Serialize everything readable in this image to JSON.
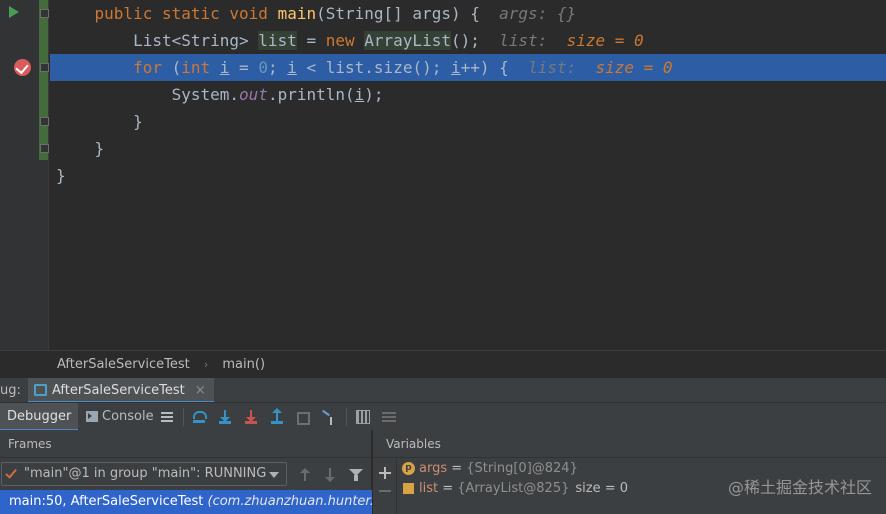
{
  "editor": {
    "lines": [
      {
        "indent": "    ",
        "parts": [
          {
            "t": "public static void ",
            "c": "kw"
          },
          {
            "t": "main",
            "c": "fn"
          },
          {
            "t": "(String[] args) {  ",
            "c": ""
          },
          {
            "t": "args: {}",
            "c": "hint"
          }
        ]
      },
      {
        "indent": "        ",
        "parts": [
          {
            "t": "List<String> ",
            "c": ""
          },
          {
            "t": "list",
            "c": "hl"
          },
          {
            "t": " = ",
            "c": ""
          },
          {
            "t": "new ",
            "c": "kw"
          },
          {
            "t": "ArrayList",
            "c": "hl"
          },
          {
            "t": "();  ",
            "c": ""
          },
          {
            "t": "list:  ",
            "c": "hint"
          },
          {
            "t": "size = 0",
            "c": "hint-val"
          }
        ]
      },
      {
        "indent": "        ",
        "exec": true,
        "parts": [
          {
            "t": "for ",
            "c": "kw"
          },
          {
            "t": "(",
            "c": ""
          },
          {
            "t": "int ",
            "c": "kw"
          },
          {
            "t": "i",
            "c": "ul"
          },
          {
            "t": " = ",
            "c": ""
          },
          {
            "t": "0",
            "c": "num"
          },
          {
            "t": "; ",
            "c": ""
          },
          {
            "t": "i",
            "c": "ul"
          },
          {
            "t": " < list.size(); ",
            "c": ""
          },
          {
            "t": "i",
            "c": "ul"
          },
          {
            "t": "++) {  ",
            "c": ""
          },
          {
            "t": "list:  ",
            "c": "hint"
          },
          {
            "t": "size = 0",
            "c": "hint-val"
          }
        ]
      },
      {
        "indent": "            ",
        "parts": [
          {
            "t": "System.",
            "c": ""
          },
          {
            "t": "out",
            "c": "it"
          },
          {
            "t": ".println(",
            "c": ""
          },
          {
            "t": "i",
            "c": "ul"
          },
          {
            "t": ");",
            "c": ""
          }
        ]
      },
      {
        "indent": "        ",
        "parts": [
          {
            "t": "}",
            "c": ""
          }
        ]
      },
      {
        "indent": "    ",
        "parts": [
          {
            "t": "}",
            "c": ""
          }
        ]
      },
      {
        "indent": "",
        "parts": [
          {
            "t": "}",
            "c": ""
          }
        ]
      }
    ]
  },
  "breadcrumb": {
    "class_name": "AfterSaleServiceTest",
    "separator": "›",
    "method": "main()"
  },
  "debug_window": {
    "prefix": "ug:",
    "tab_label": "AfterSaleServiceTest",
    "tab_close": "×"
  },
  "toolbar": {
    "debugger_tab": "Debugger",
    "console_tab": "Console"
  },
  "frames": {
    "title": "Frames",
    "thread_label": "\"main\"@1 in group \"main\": RUNNING",
    "frame_method": "main:50, AfterSaleServiceTest ",
    "frame_location": "(com.zhuanzhuan.hunter.qa.service"
  },
  "variables": {
    "title": "Variables",
    "items": [
      {
        "icon": "p",
        "name": "args",
        "eq": " = ",
        "value": "{String[0]@824}",
        "extra": ""
      },
      {
        "icon": "f",
        "name": "list",
        "eq": " = ",
        "value": "{ArrayList@825}",
        "extra": "size = 0"
      }
    ]
  },
  "watermark": "@稀土掘金技术社区"
}
